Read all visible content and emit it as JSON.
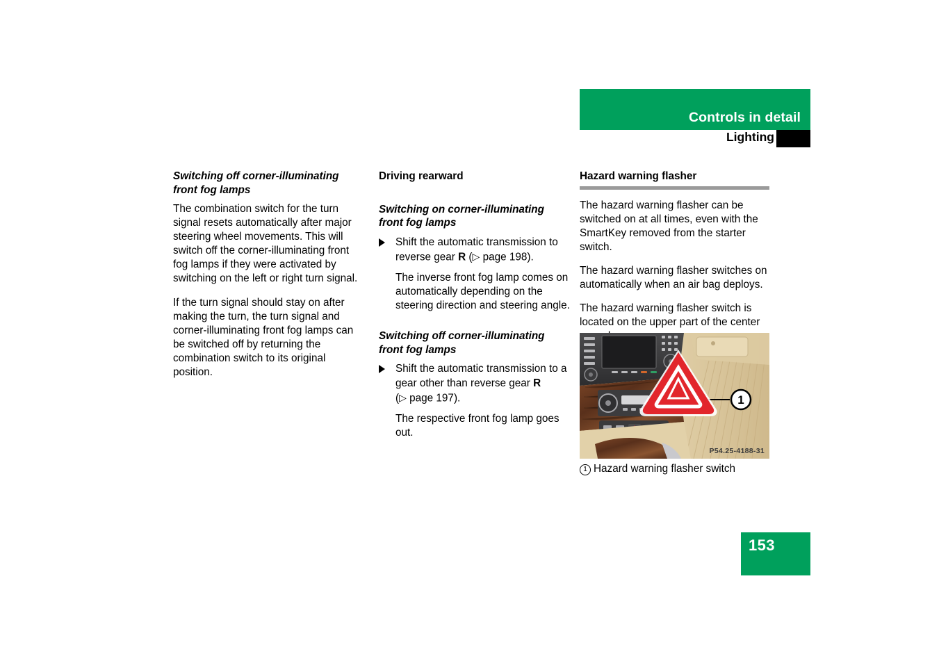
{
  "header": {
    "chapter_title": "Controls in detail",
    "section_title": "Lighting",
    "green_color": "#00a05c",
    "tab_color": "#000000"
  },
  "page_number": "153",
  "columns": {
    "left": {
      "heading": "Switching off corner-illuminating front fog lamps",
      "paragraphs": [
        "The combination switch for the turn signal resets automatically after major steering wheel movements. This will switch off the corner-illuminating front fog lamps if they were activated by switching on the left or right turn signal.",
        "If the turn signal should stay on after making the turn, the turn signal and corner-illuminating front fog lamps can be switched off by returning the combination switch to its original position."
      ]
    },
    "middle": {
      "heading": "Driving rearward",
      "subheading_on": "Switching on corner-illuminating front fog lamps",
      "step_on": {
        "text_a": "Shift the automatic transmission to reverse gear ",
        "gear": "R",
        "text_b": " (",
        "ref_icon": "▷",
        "ref_text": " page 198).",
        "result": "The inverse front fog lamp comes on automatically depending on the steering direction and steering angle."
      },
      "subheading_off": "Switching off corner-illuminating front fog lamps",
      "step_off": {
        "text_a": "Shift the automatic transmission to a gear other than reverse gear ",
        "gear": "R",
        "text_b": "(",
        "ref_icon": "▷",
        "ref_text": " page 197).",
        "result": "The respective front fog lamp goes out."
      }
    },
    "right": {
      "heading": "Hazard warning flasher",
      "paragraphs": [
        "The hazard warning flasher can be switched on at all times, even with the SmartKey removed from the starter switch.",
        "The hazard warning flasher switches on automatically when an air bag deploys.",
        "The hazard warning flasher switch is located on the upper part of the center console."
      ],
      "figure": {
        "image_code": "P54.25-4188-31",
        "callout_number": "1",
        "caption_number": "1",
        "caption_text": "Hazard warning flasher switch"
      }
    }
  }
}
